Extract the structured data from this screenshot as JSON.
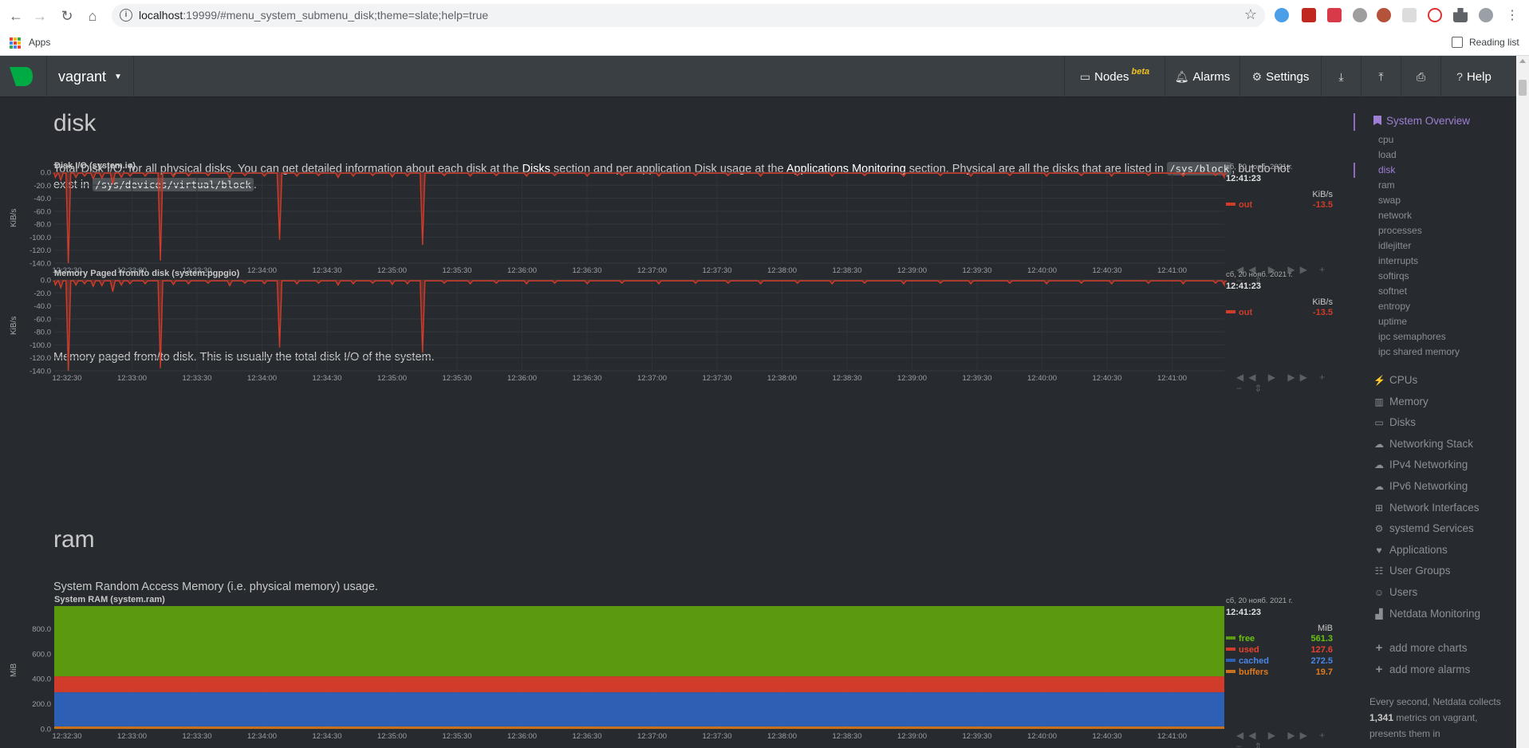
{
  "browser": {
    "url_host": "localhost",
    "url_rest": ":19999/#menu_system_submenu_disk;theme=slate;help=true",
    "apps_label": "Apps",
    "reading_list_label": "Reading list"
  },
  "header": {
    "host": "vagrant",
    "nav": [
      {
        "label": "Nodes",
        "badge": "beta",
        "icon": "monitor-icon"
      },
      {
        "label": "Alarms",
        "icon": "bell-icon"
      },
      {
        "label": "Settings",
        "icon": "gear-icon"
      },
      {
        "label": "",
        "icon": "download-icon"
      },
      {
        "label": "",
        "icon": "upload-icon"
      },
      {
        "label": "",
        "icon": "print-icon"
      },
      {
        "label": "Help",
        "icon": "question-icon"
      }
    ]
  },
  "disk": {
    "title": "disk",
    "desc_pre": "Total Disk I/O, for all physical disks. You can get detailed information about each disk at the ",
    "desc_disks": "Disks",
    "desc_mid": " section and per application Disk usage at the ",
    "desc_apps": "Applications Monitoring",
    "desc_post": " section. Physical are all the disks that are listed in ",
    "desc_code1": "/sys/block",
    "desc_post2": ", but do not exist in ",
    "desc_code2": "/sys/devices/virtual/block",
    "desc_end": ".",
    "pg_desc": "Memory paged from/to disk. This is usually the total disk I/O of the system."
  },
  "ram": {
    "title": "ram",
    "desc": "System Random Access Memory (i.e. physical memory) usage."
  },
  "legend_common": {
    "date": "сб, 20 нояб. 2021 г.",
    "time": "12:41:23"
  },
  "chart_data": [
    {
      "type": "area",
      "title": "Disk I/O (system.io)",
      "ylabel": "KiB/s",
      "units": "KiB/s",
      "ylim": [
        -140,
        0
      ],
      "yticks": [
        "0.0",
        "-20.0",
        "-40.0",
        "-60.0",
        "-80.0",
        "-100.0",
        "-120.0",
        "-140.0"
      ],
      "xticks": [
        "12:32:30",
        "12:33:00",
        "12:33:30",
        "12:34:00",
        "12:34:30",
        "12:35:00",
        "12:35:30",
        "12:36:00",
        "12:36:30",
        "12:37:00",
        "12:37:30",
        "12:38:00",
        "12:38:30",
        "12:39:00",
        "12:39:30",
        "12:40:00",
        "12:40:30",
        "12:41:00"
      ],
      "series": [
        {
          "name": "out",
          "color": "#d13c2a",
          "last": "-13.5",
          "spikes": [
            [
              0.5,
              -8
            ],
            [
              3,
              -12
            ],
            [
              6.5,
              -140
            ],
            [
              10,
              -8
            ],
            [
              14,
              -6
            ],
            [
              18,
              -10
            ],
            [
              22,
              -9
            ],
            [
              27,
              -18
            ],
            [
              31,
              -8
            ],
            [
              35,
              -6
            ],
            [
              42,
              -6
            ],
            [
              49,
              -136
            ],
            [
              55,
              -7
            ],
            [
              62,
              -6
            ],
            [
              71,
              -5
            ],
            [
              81,
              -9
            ],
            [
              88,
              -5
            ],
            [
              97,
              -6
            ],
            [
              104,
              -104
            ],
            [
              112,
              -6
            ],
            [
              122,
              -5
            ],
            [
              131,
              -8
            ],
            [
              138,
              -6
            ],
            [
              147,
              -5
            ],
            [
              156,
              -7
            ],
            [
              163,
              -6
            ],
            [
              170,
              -112
            ],
            [
              180,
              -5
            ],
            [
              192,
              -6
            ],
            [
              204,
              -5
            ],
            [
              218,
              -6
            ],
            [
              231,
              -5
            ],
            [
              246,
              -6
            ],
            [
              262,
              -5
            ],
            [
              279,
              -6
            ],
            [
              296,
              -5
            ],
            [
              311,
              -5
            ],
            [
              326,
              -6
            ],
            [
              343,
              -5
            ],
            [
              359,
              -6
            ],
            [
              374,
              -5
            ],
            [
              392,
              -6
            ],
            [
              409,
              -5
            ],
            [
              423,
              -6
            ],
            [
              441,
              -5
            ],
            [
              458,
              -6
            ],
            [
              474,
              -5
            ],
            [
              488,
              -6
            ],
            [
              505,
              -5
            ],
            [
              521,
              -6
            ],
            [
              536,
              -5
            ],
            [
              540,
              -8
            ]
          ]
        }
      ]
    },
    {
      "type": "area",
      "title": "Memory Paged from/to disk (system.pgpgio)",
      "ylabel": "KiB/s",
      "units": "KiB/s",
      "ylim": [
        -140,
        0
      ],
      "yticks": [
        "0.0",
        "-20.0",
        "-40.0",
        "-60.0",
        "-80.0",
        "-100.0",
        "-120.0",
        "-140.0"
      ],
      "xticks": [
        "12:32:30",
        "12:33:00",
        "12:33:30",
        "12:34:00",
        "12:34:30",
        "12:35:00",
        "12:35:30",
        "12:36:00",
        "12:36:30",
        "12:37:00",
        "12:37:30",
        "12:38:00",
        "12:38:30",
        "12:39:00",
        "12:39:30",
        "12:40:00",
        "12:40:30",
        "12:41:00"
      ],
      "series": [
        {
          "name": "out",
          "color": "#d13c2a",
          "last": "-13.5",
          "spikes": [
            [
              0.5,
              -8
            ],
            [
              3,
              -12
            ],
            [
              6.5,
              -140
            ],
            [
              10,
              -8
            ],
            [
              14,
              -6
            ],
            [
              18,
              -10
            ],
            [
              22,
              -9
            ],
            [
              27,
              -18
            ],
            [
              31,
              -8
            ],
            [
              35,
              -6
            ],
            [
              42,
              -6
            ],
            [
              49,
              -136
            ],
            [
              55,
              -7
            ],
            [
              62,
              -6
            ],
            [
              71,
              -5
            ],
            [
              81,
              -9
            ],
            [
              88,
              -5
            ],
            [
              97,
              -6
            ],
            [
              104,
              -104
            ],
            [
              112,
              -6
            ],
            [
              122,
              -5
            ],
            [
              131,
              -8
            ],
            [
              138,
              -6
            ],
            [
              147,
              -5
            ],
            [
              156,
              -7
            ],
            [
              163,
              -6
            ],
            [
              170,
              -112
            ],
            [
              180,
              -5
            ],
            [
              192,
              -6
            ],
            [
              204,
              -5
            ],
            [
              218,
              -6
            ],
            [
              231,
              -5
            ],
            [
              246,
              -6
            ],
            [
              262,
              -5
            ],
            [
              279,
              -6
            ],
            [
              296,
              -5
            ],
            [
              311,
              -5
            ],
            [
              326,
              -6
            ],
            [
              343,
              -5
            ],
            [
              359,
              -6
            ],
            [
              374,
              -5
            ],
            [
              392,
              -6
            ],
            [
              409,
              -5
            ],
            [
              423,
              -6
            ],
            [
              441,
              -5
            ],
            [
              458,
              -6
            ],
            [
              474,
              -5
            ],
            [
              488,
              -6
            ],
            [
              505,
              -5
            ],
            [
              521,
              -6
            ],
            [
              536,
              -5
            ],
            [
              540,
              -8
            ]
          ]
        }
      ]
    },
    {
      "type": "area",
      "stacked": true,
      "title": "System RAM (system.ram)",
      "ylabel": "MiB",
      "units": "MiB",
      "ylim": [
        0,
        981
      ],
      "yticks": [
        "800.0",
        "600.0",
        "400.0",
        "200.0",
        "0.0"
      ],
      "xticks": [
        "12:32:30",
        "12:33:00",
        "12:33:30",
        "12:34:00",
        "12:34:30",
        "12:35:00",
        "12:35:30",
        "12:36:00",
        "12:36:30",
        "12:37:00",
        "12:37:30",
        "12:38:00",
        "12:38:30",
        "12:39:00",
        "12:39:30",
        "12:40:00",
        "12:40:30",
        "12:41:00"
      ],
      "series": [
        {
          "name": "free",
          "color": "#5b9a0f",
          "value": 561.3,
          "label": "561.3",
          "text_color": "#6ac20f"
        },
        {
          "name": "used",
          "color": "#d13c2a",
          "value": 127.6,
          "label": "127.6",
          "text_color": "#e8412c"
        },
        {
          "name": "cached",
          "color": "#2d5fb5",
          "value": 272.5,
          "label": "272.5",
          "text_color": "#4a86e8"
        },
        {
          "name": "buffers",
          "color": "#c9721e",
          "value": 19.7,
          "label": "19.7",
          "text_color": "#e07a1c"
        }
      ]
    }
  ],
  "sidebar": {
    "overview": "System Overview",
    "subitems": [
      "cpu",
      "load",
      "disk",
      "ram",
      "swap",
      "network",
      "processes",
      "idlejitter",
      "interrupts",
      "softirqs",
      "softnet",
      "entropy",
      "uptime",
      "ipc semaphores",
      "ipc shared memory"
    ],
    "active": "disk",
    "groups": [
      {
        "label": "CPUs",
        "icon": "bolt-icon",
        "glyph": "⚡"
      },
      {
        "label": "Memory",
        "icon": "memory-icon",
        "glyph": "▥"
      },
      {
        "label": "Disks",
        "icon": "hdd-icon",
        "glyph": "▭"
      },
      {
        "label": "Networking Stack",
        "icon": "cloud-icon",
        "glyph": "☁"
      },
      {
        "label": "IPv4 Networking",
        "icon": "cloud-icon",
        "glyph": "☁"
      },
      {
        "label": "IPv6 Networking",
        "icon": "cloud-icon",
        "glyph": "☁"
      },
      {
        "label": "Network Interfaces",
        "icon": "sitemap-icon",
        "glyph": "⊞"
      },
      {
        "label": "systemd Services",
        "icon": "cogs-icon",
        "glyph": "⚙"
      },
      {
        "label": "Applications",
        "icon": "heartbeat-icon",
        "glyph": "♥"
      },
      {
        "label": "User Groups",
        "icon": "users-icon",
        "glyph": "☷"
      },
      {
        "label": "Users",
        "icon": "user-icon",
        "glyph": "☺"
      },
      {
        "label": "Netdata Monitoring",
        "icon": "bar-chart-icon",
        "glyph": "▟"
      }
    ],
    "actions": [
      {
        "label": "add more charts",
        "icon": "plus-icon"
      },
      {
        "label": "add more alarms",
        "icon": "plus-icon"
      }
    ],
    "footer_pre": "Every second, Netdata collects ",
    "footer_count": "1,341",
    "footer_mid": " metrics on vagrant, presents them in"
  }
}
